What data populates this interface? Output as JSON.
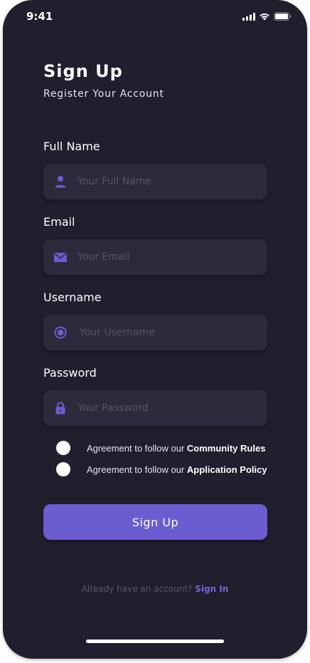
{
  "status_bar": {
    "time": "9:41",
    "icons": [
      "signal-icon",
      "wifi-icon",
      "battery-icon"
    ]
  },
  "header": {
    "title": "Sign Up",
    "subtitle": "Register Your Account"
  },
  "form": {
    "full_name": {
      "label": "Full Name",
      "placeholder": "Your Full Name",
      "value": "",
      "icon": "user-icon"
    },
    "email": {
      "label": "Email",
      "placeholder": "Your Email",
      "value": "",
      "icon": "mail-icon"
    },
    "username": {
      "label": "Username",
      "placeholder": "Your Username",
      "value": "",
      "icon": "radio-dot-icon"
    },
    "password": {
      "label": "Password",
      "placeholder": "Your Password",
      "value": "",
      "icon": "lock-icon"
    }
  },
  "agreements": [
    {
      "prefix": "Agreement to follow our ",
      "link": "Community Rules",
      "checked": false
    },
    {
      "prefix": "Agreement to follow our ",
      "link": "Application Policy",
      "checked": false
    }
  ],
  "signup_button": {
    "label": "Sign Up"
  },
  "footer": {
    "prompt": "Already have an account?",
    "link": "Sign In"
  },
  "colors": {
    "background": "#211e2e",
    "field": "#2d2a3b",
    "accent": "#6b5dcf",
    "link": "#7468dd",
    "placeholder": "#57536a"
  }
}
